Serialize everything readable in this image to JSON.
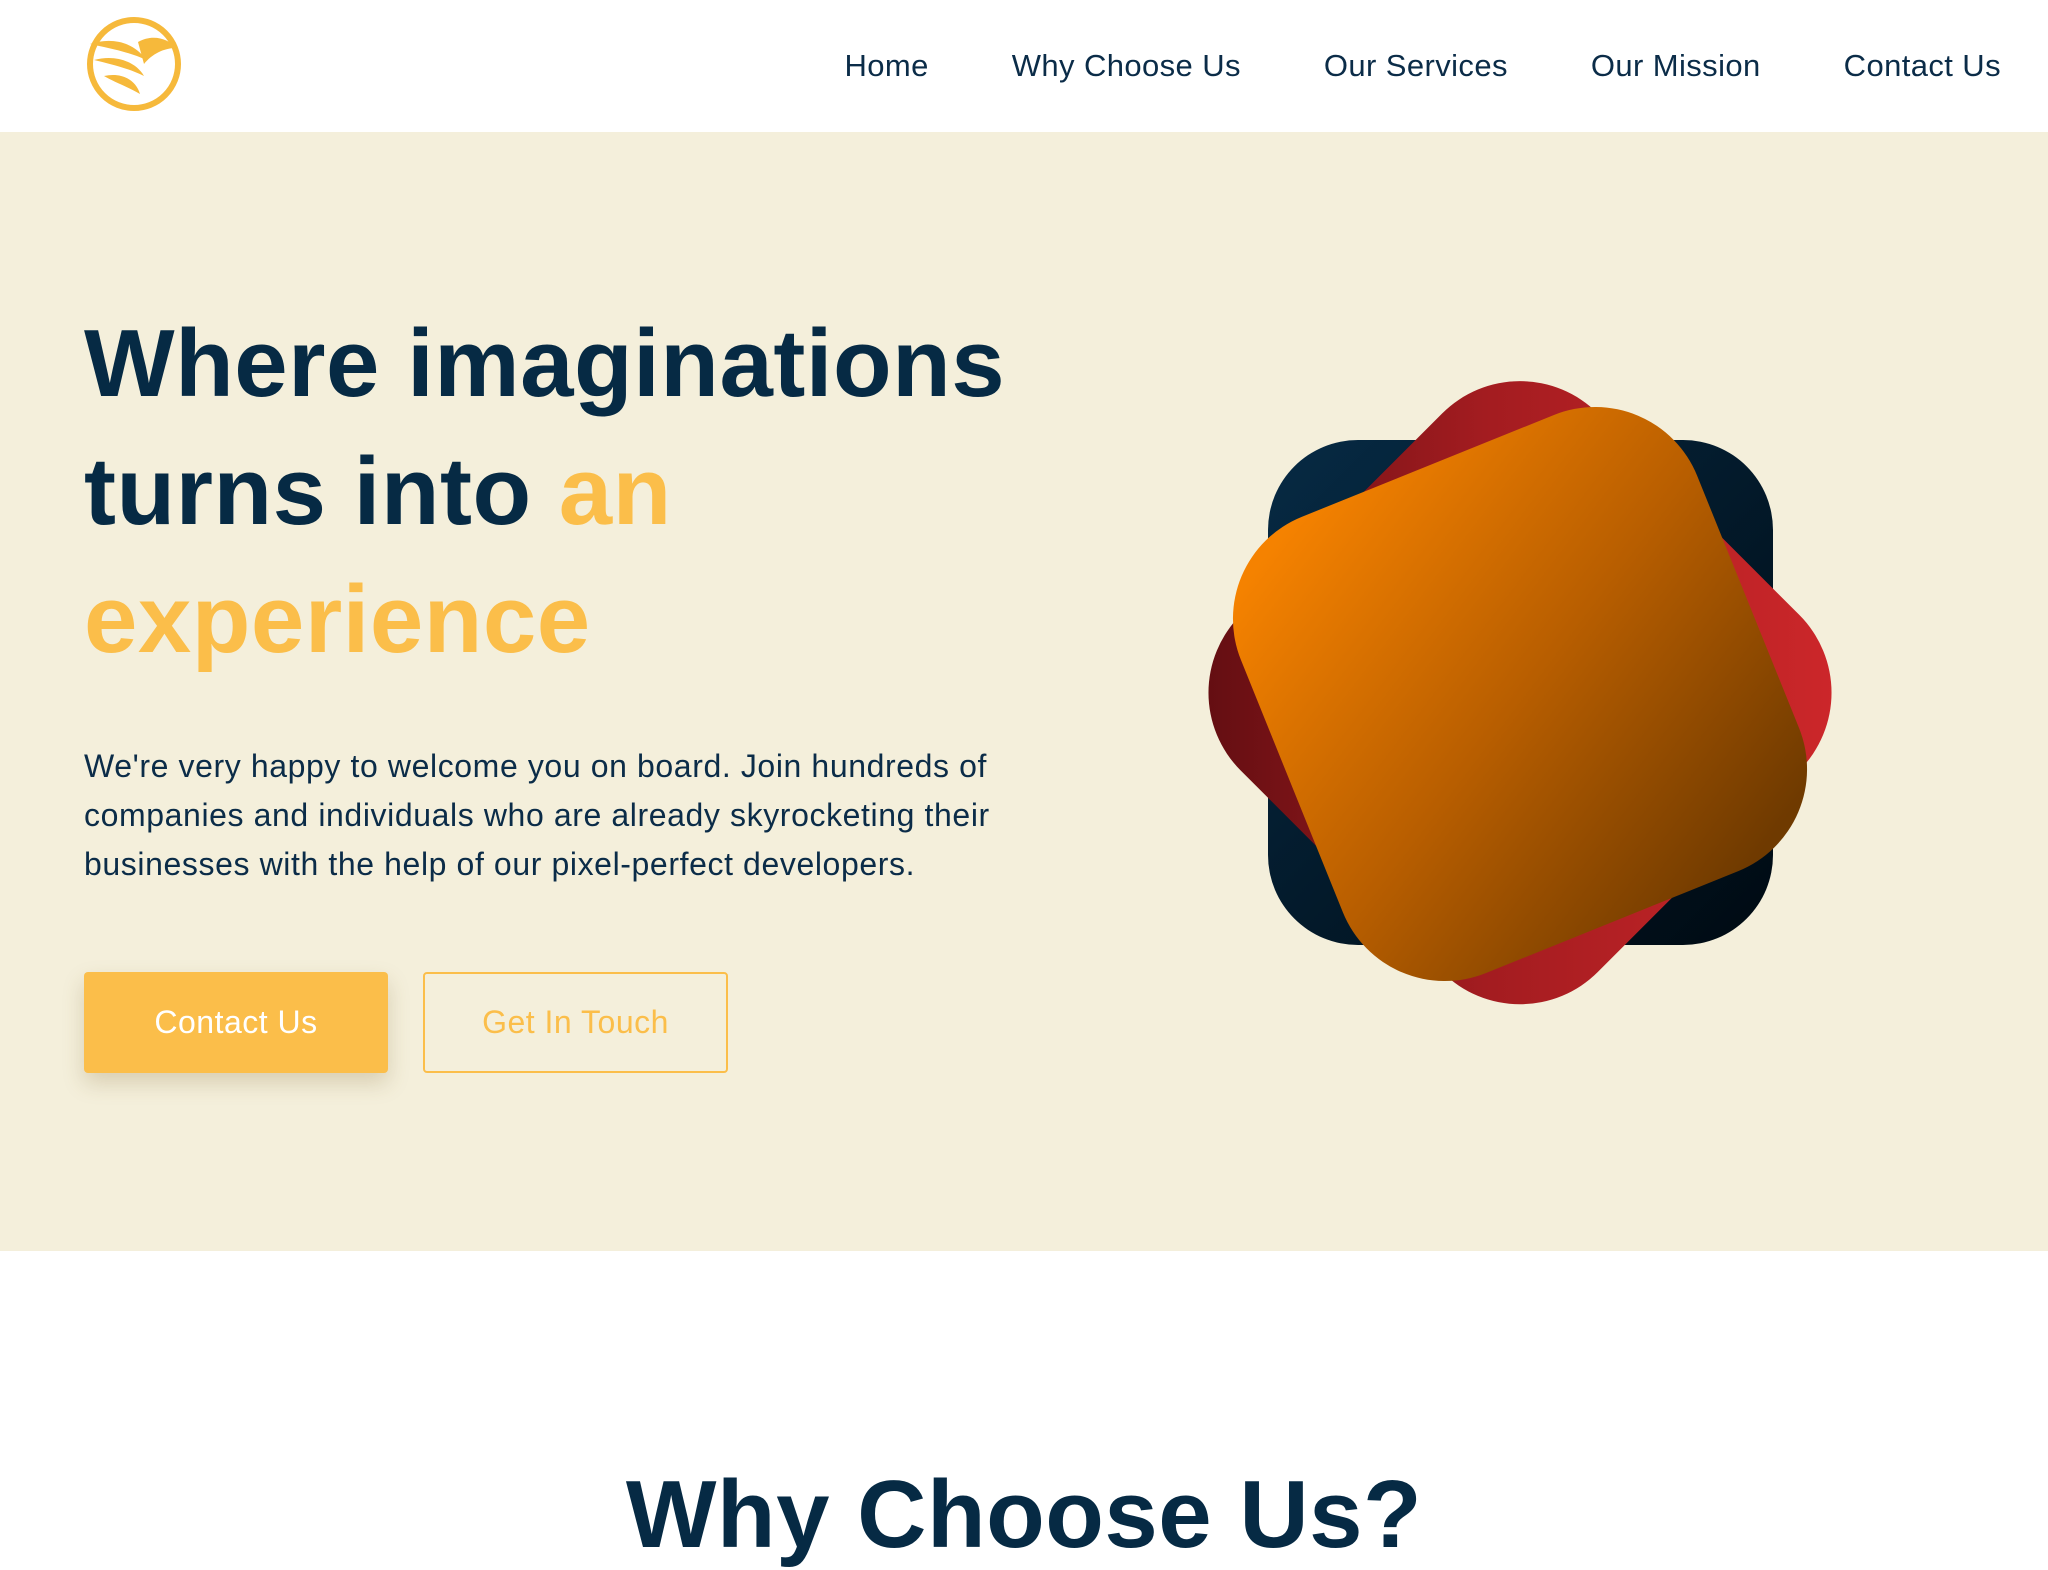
{
  "header": {
    "logo_icon": "bird-wings-logo-icon",
    "nav": [
      {
        "label": "Home"
      },
      {
        "label": "Why Choose Us"
      },
      {
        "label": "Our Services"
      },
      {
        "label": "Our Mission"
      },
      {
        "label": "Contact Us"
      }
    ]
  },
  "hero": {
    "headline_part1": "Where imaginations turns into ",
    "headline_accent": "an experience",
    "lead": "We're very happy to welcome you on board. Join hundreds of companies and individuals who are already skyrocketing their businesses with the help of our pixel-perfect developers.",
    "primary_button": "Contact Us",
    "secondary_button": "Get In Touch",
    "illustration": "stacked-rounded-squares-icon"
  },
  "why_section": {
    "title": "Why Choose Us?"
  },
  "colors": {
    "navy": "#062a44",
    "accent_yellow": "#fbbe4a",
    "hero_background": "#f4efdb",
    "red": "#d1282b",
    "orange": "#f37d00"
  }
}
